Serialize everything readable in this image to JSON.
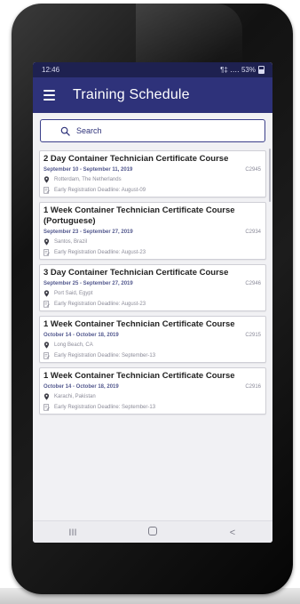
{
  "status_bar": {
    "time": "12:46",
    "indicators": "¶‡ ‥‥ 53%"
  },
  "app_bar": {
    "menu_icon": "hamburger-menu-icon",
    "title": "Training Schedule"
  },
  "search": {
    "icon": "search-icon",
    "label": "Search"
  },
  "courses": [
    {
      "title": "2 Day Container Technician Certificate Course",
      "dates": "September 10 - September 11, 2019",
      "code": "C2945",
      "location": "Rotterdam, The Netherlands",
      "deadline": "Early Registration Deadline: August-09"
    },
    {
      "title": "1 Week Container Technician Certificate Course (Portuguese)",
      "dates": "September 23 - September 27, 2019",
      "code": "C2934",
      "location": "Santos, Brazil",
      "deadline": "Early Registration Deadline: August-23"
    },
    {
      "title": "3 Day Container Technician Certificate Course",
      "dates": "September 25 - September 27, 2019",
      "code": "C2946",
      "location": "Port Said, Egypt",
      "deadline": "Early Registration Deadline: August-23"
    },
    {
      "title": "1 Week Container Technician Certificate Course",
      "dates": "October 14 - October 18, 2019",
      "code": "C2915",
      "location": "Long Beach, CA",
      "deadline": "Early Registration Deadline: September-13"
    },
    {
      "title": "1 Week Container Technician Certificate Course",
      "dates": "October 14 - October 18, 2019",
      "code": "C2916",
      "location": "Karachi, Pakistan",
      "deadline": "Early Registration Deadline: September-13"
    }
  ],
  "nav_bar": {
    "recents": "III",
    "back": "<"
  },
  "colors": {
    "app_bar": "#2e327a",
    "status_bar": "#1e2150",
    "accent": "#3b3f8a"
  }
}
